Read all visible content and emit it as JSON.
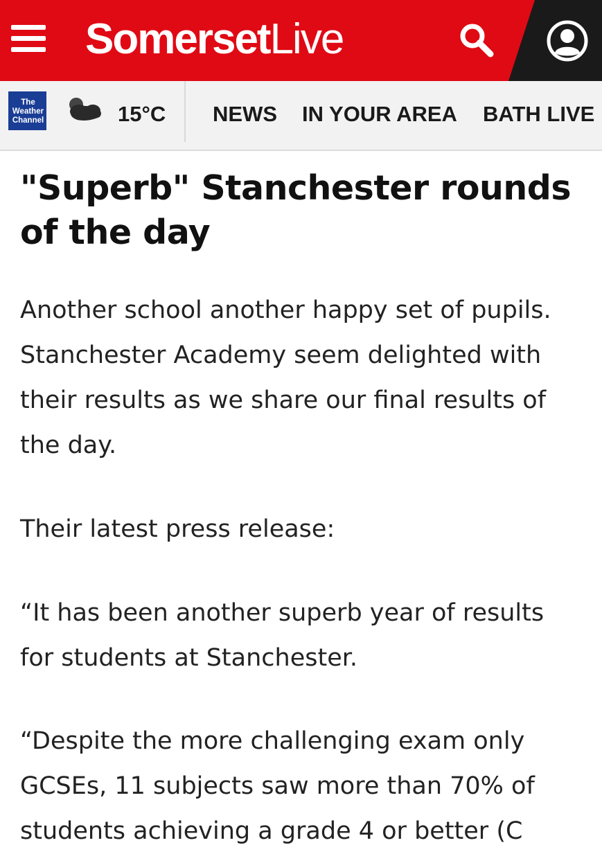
{
  "header": {
    "brand_bold": "Somerset",
    "brand_light": "Live",
    "colors": {
      "brand_red": "#e00a14",
      "account_bg": "#1a1a1a"
    },
    "icons": {
      "menu": "hamburger-menu-icon",
      "search": "search-icon",
      "account": "account-icon"
    }
  },
  "subnav": {
    "weather_logo_text": [
      "The",
      "Weather",
      "Channel"
    ],
    "weather_icon": "partly-cloudy-icon",
    "temperature": "15°C",
    "items": [
      {
        "label": "NEWS"
      },
      {
        "label": "IN YOUR AREA"
      },
      {
        "label": "BATH LIVE"
      }
    ]
  },
  "article": {
    "headline": "\"Superb\" Stanchester rounds of the day",
    "paragraphs": [
      "Another school another happy set of pupils. Stanchester Academy seem delighted with their results as we share our final results of the day.",
      "Their latest press release:",
      "“It has been another superb year of results for students at Stanchester.",
      "“Despite the more challenging exam only GCSEs, 11 subjects saw more than 70% of students achieving a grade 4 or better (C"
    ]
  }
}
